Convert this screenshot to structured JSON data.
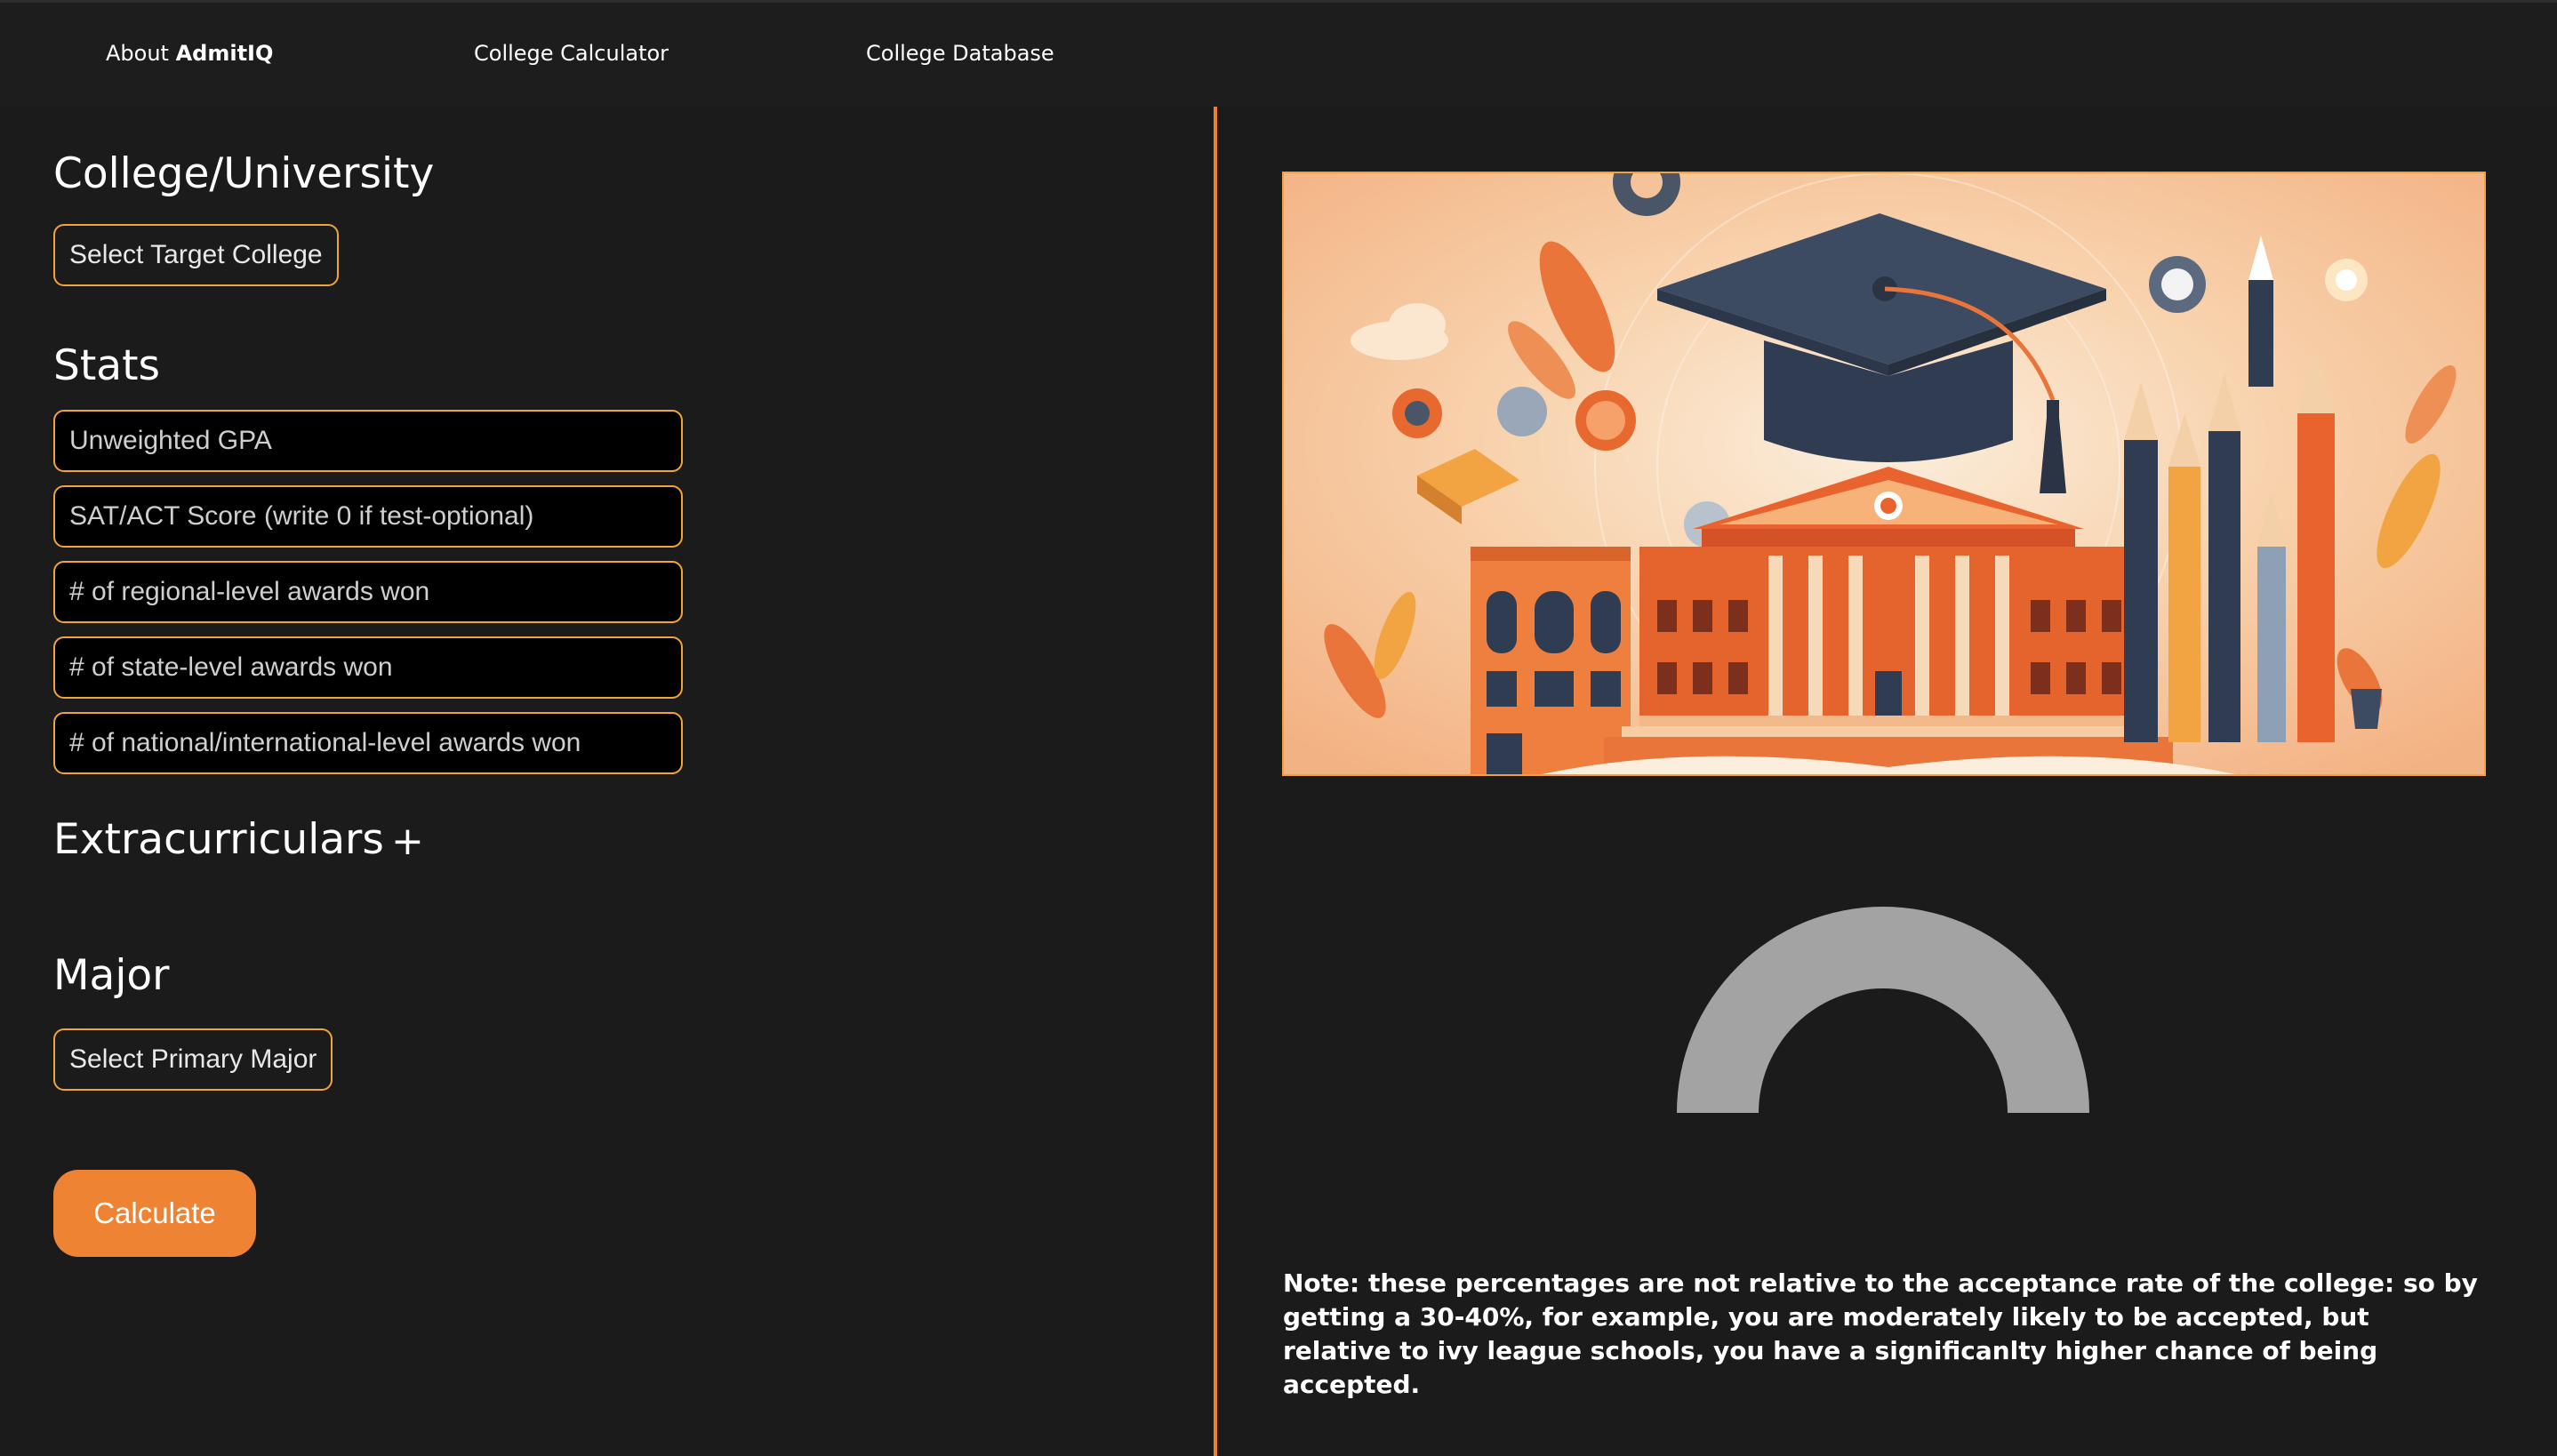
{
  "nav": {
    "about_prefix": "About ",
    "about_brand": "AdmitIQ",
    "calculator": "College Calculator",
    "database": "College Database"
  },
  "college": {
    "title": "College/University",
    "select_label": "Select Target College"
  },
  "stats": {
    "title": "Stats",
    "fields": [
      {
        "placeholder": "Unweighted GPA",
        "value": ""
      },
      {
        "placeholder": "SAT/ACT Score (write 0 if test-optional)",
        "value": ""
      },
      {
        "placeholder": "# of regional-level awards won",
        "value": ""
      },
      {
        "placeholder": "# of state-level awards won",
        "value": ""
      },
      {
        "placeholder": "# of national/international-level awards won",
        "value": ""
      }
    ]
  },
  "extracurriculars": {
    "title": "Extracurriculars",
    "add_icon": "plus-icon"
  },
  "major": {
    "title": "Major",
    "select_label": "Select Primary Major"
  },
  "calculate_label": "Calculate",
  "hero": {
    "image": "graduation-cap-college-illustration"
  },
  "gauge": {
    "color": "#a3a3a3"
  },
  "note": "Note: these percentages are not relative to the acceptance rate of the college: so by getting a 30-40%, for example, you are moderately likely to be accepted, but relative to ivy league schools, you have a significanlty higher chance of being accepted.",
  "colors": {
    "accent": "#ee8433",
    "border": "#f0a43c",
    "background": "#1b1b1b"
  }
}
